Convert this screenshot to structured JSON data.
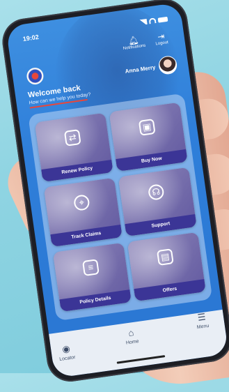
{
  "status_bar": {
    "time": "19:02"
  },
  "header": {
    "notifications_label": "Notifications",
    "logout_label": "Logout",
    "user_name": "Anna Merry",
    "welcome_title": "Welcome back",
    "welcome_subtitle": "How can we help you today?"
  },
  "cards": [
    {
      "label": "Renew Policy",
      "icon": "refresh-icon"
    },
    {
      "label": "Buy Now",
      "icon": "cart-icon"
    },
    {
      "label": "Track Claims",
      "icon": "location-pin-icon"
    },
    {
      "label": "Support",
      "icon": "headset-icon"
    },
    {
      "label": "Policy Details",
      "icon": "document-icon"
    },
    {
      "label": "Offers",
      "icon": "offers-icon"
    }
  ],
  "bottom_nav": {
    "locator_label": "Locator",
    "home_label": "Home",
    "menu_label": "Menu"
  },
  "colors": {
    "accent": "#2f7fda",
    "card_label_bg": "#3b3596",
    "underline": "#e8473b"
  }
}
